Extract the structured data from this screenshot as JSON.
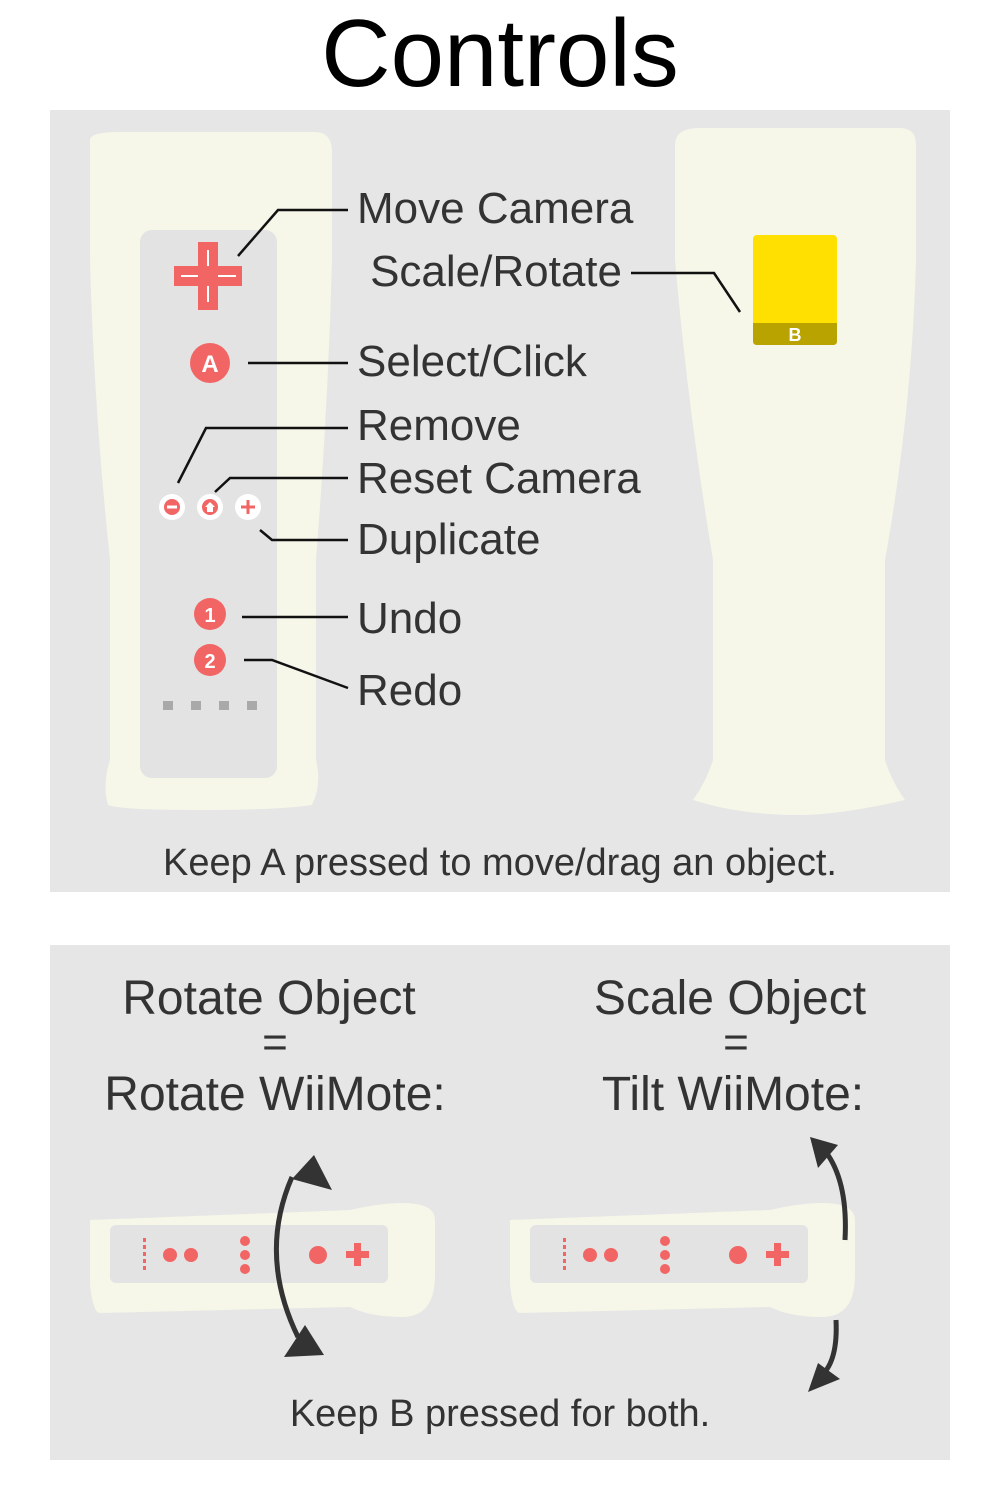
{
  "title": "Controls",
  "controls_panel": {
    "labels": {
      "move_camera": "Move Camera",
      "scale_rotate": "Scale/Rotate",
      "select_click": "Select/Click",
      "remove": "Remove",
      "reset_camera": "Reset Camera",
      "duplicate": "Duplicate",
      "undo": "Undo",
      "redo": "Redo"
    },
    "buttons": {
      "a": "A",
      "b": "B",
      "one": "1",
      "two": "2",
      "minus": "−",
      "plus": "+"
    },
    "footer": "Keep A pressed to move/drag an object."
  },
  "gestures_panel": {
    "rotate": {
      "line1": "Rotate Object",
      "eq": "=",
      "line2": "Rotate WiiMote:"
    },
    "scale": {
      "line1": "Scale Object",
      "eq": "=",
      "line2": "Tilt WiiMote:"
    },
    "footer": "Keep B pressed for both."
  },
  "colors": {
    "panel_bg": "#e6e6e6",
    "remote_body": "#f6f6e9",
    "button_face": "#e3e3e3",
    "accent_red": "#f26565",
    "b_trigger": "#ffe000",
    "b_trigger_dark": "#b8a300",
    "leader_line": "#111111",
    "arrow": "#333333"
  }
}
